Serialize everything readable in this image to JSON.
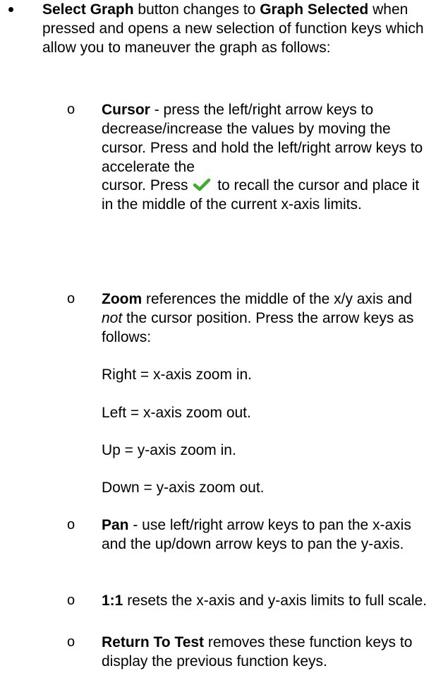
{
  "intro": {
    "bold1": "Select Graph",
    "text1": " button changes to ",
    "bold2": "Graph Selected",
    "text2": " when pressed and opens a new selection of function keys which allow you to maneuver the graph as follows:"
  },
  "sub_marker": "o",
  "cursor": {
    "term": "Cursor",
    "text_a": " - press the left/right arrow keys to decrease/increase the values by moving the cursor. Press and hold the left/right arrow keys to accelerate the",
    "text_b_pre": "cursor. Press ",
    "check_icon": "green-check-icon",
    "text_b_post": " to recall the cursor and place it in the middle of the current x-axis limits."
  },
  "zoom": {
    "term": "Zoom",
    "text_a": " references the middle of the x/y axis and ",
    "italic": "not",
    "text_b": " the cursor position. Press the arrow keys as follows:",
    "lines": [
      "Right = x-axis zoom in.",
      "Left = x-axis zoom out.",
      "Up = y-axis zoom in.",
      "Down = y-axis zoom out."
    ]
  },
  "pan": {
    "term": "Pan",
    "text": " - use left/right arrow keys to pan the x-axis and the up/down arrow keys to pan the y-axis."
  },
  "one_to_one": {
    "term": "1:1",
    "text": " resets the x-axis and y-axis limits to full scale."
  },
  "return_to_test": {
    "term": "Return To Test",
    "text": " removes these function keys to display the previous function keys."
  },
  "colors": {
    "check": "#3dae2b",
    "text": "#000000"
  }
}
